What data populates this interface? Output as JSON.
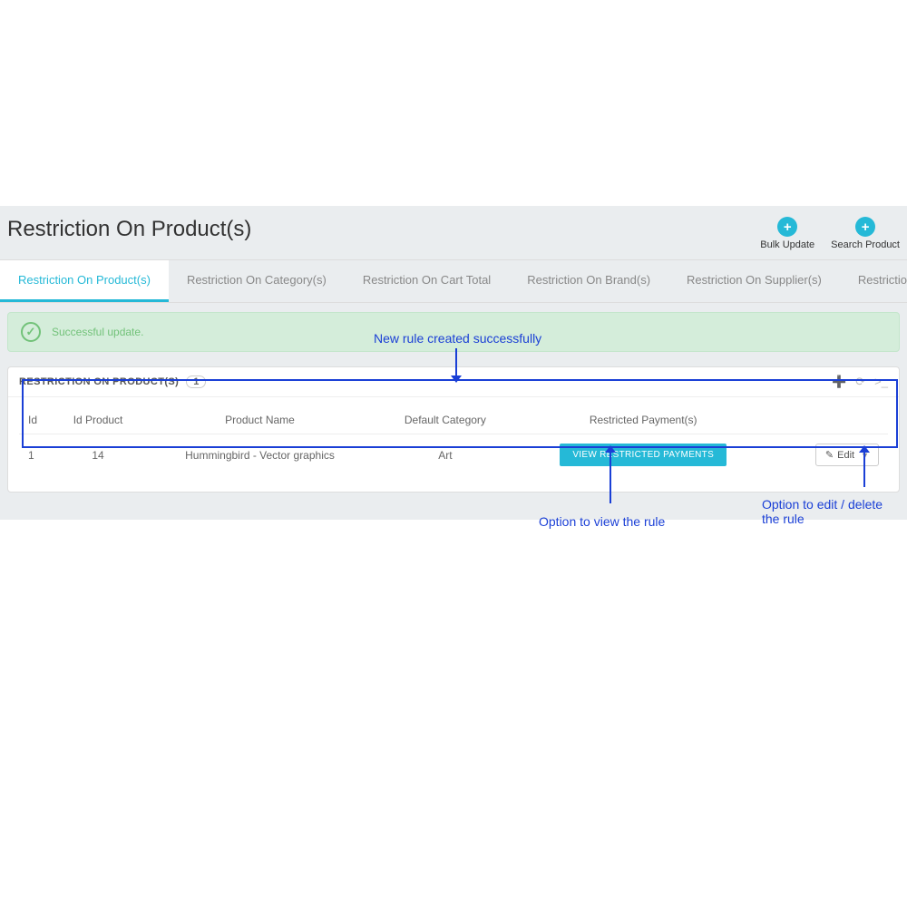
{
  "header": {
    "title": "Restriction On Product(s)",
    "actions": [
      {
        "label": "Bulk Update"
      },
      {
        "label": "Search Product"
      }
    ]
  },
  "tabs": [
    {
      "label": "Restriction On Product(s)",
      "active": true
    },
    {
      "label": "Restriction On Category(s)"
    },
    {
      "label": "Restriction On Cart Total"
    },
    {
      "label": "Restriction On Brand(s)"
    },
    {
      "label": "Restriction On Supplier(s)"
    },
    {
      "label": "Restriction On Group(s)"
    }
  ],
  "alert": {
    "text": "Successful update."
  },
  "panel": {
    "title": "RESTRICTION ON PRODUCT(S)",
    "count": "1",
    "columns": {
      "id": "Id",
      "id_product": "Id Product",
      "product_name": "Product Name",
      "default_category": "Default Category",
      "restricted_payments": "Restricted Payment(s)"
    },
    "row": {
      "id": "1",
      "id_product": "14",
      "product_name": "Hummingbird - Vector graphics",
      "default_category": "Art",
      "view_button": "VIEW RESTRICTED PAYMENTS",
      "edit_label": "Edit"
    }
  },
  "annotations": {
    "a1": "New rule created successfully",
    "a2": "Option to view the rule",
    "a3": "Option to edit / delete the rule"
  }
}
